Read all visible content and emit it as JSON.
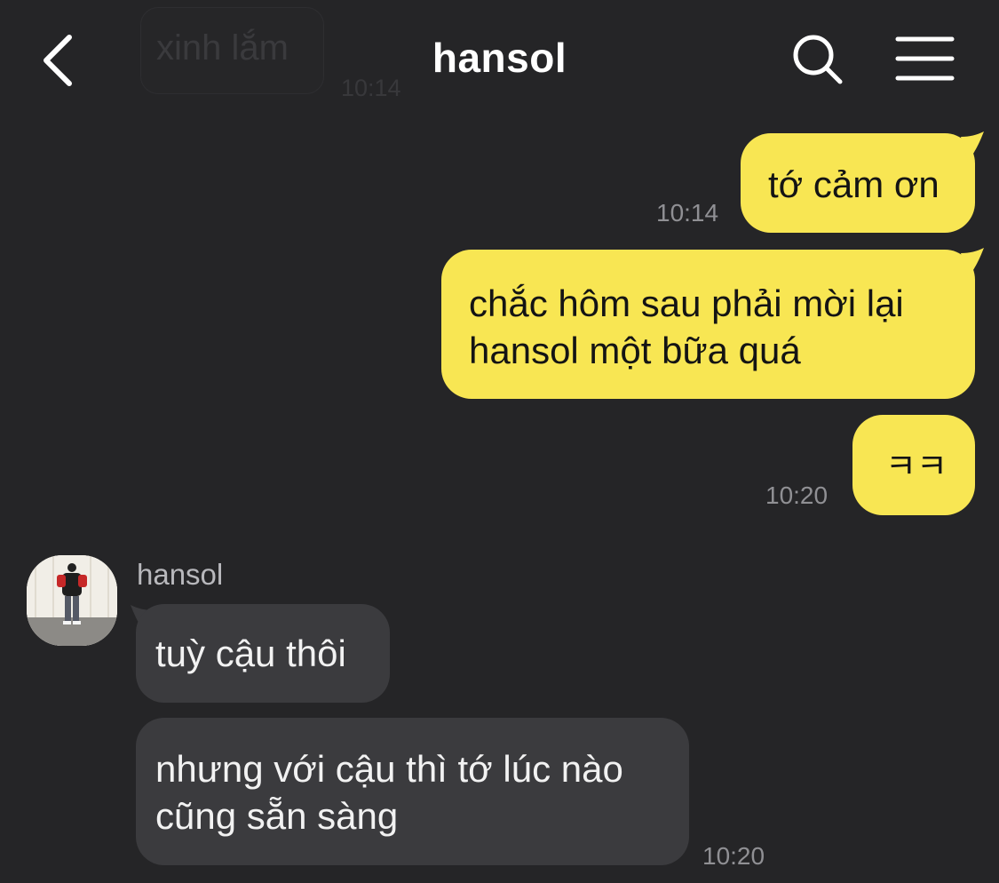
{
  "header": {
    "title": "hansol"
  },
  "faded_message": {
    "text": "xinh lắm",
    "time": "10:14"
  },
  "messages": [
    {
      "direction": "out",
      "text": "tớ cảm ơn",
      "time": "10:14"
    },
    {
      "direction": "out",
      "lines": [
        "chắc hôm sau phải mời lại",
        "hansol một bữa quá"
      ],
      "time": ""
    },
    {
      "direction": "out",
      "text": "ㅋㅋ",
      "time": "10:20"
    },
    {
      "direction": "in",
      "sender": "hansol",
      "text": "tuỳ cậu thôi",
      "time": ""
    },
    {
      "direction": "in",
      "lines": [
        "nhưng với cậu thì tớ lúc nào",
        "cũng sẵn sàng"
      ],
      "time": "10:20"
    }
  ],
  "icons": {
    "back": "chevron-left-icon",
    "search": "search-icon",
    "menu": "hamburger-menu-icon"
  },
  "colors": {
    "background": "#252527",
    "outgoing_bubble": "#f8e653",
    "incoming_bubble": "#3b3b3e",
    "timestamp": "#909094"
  }
}
